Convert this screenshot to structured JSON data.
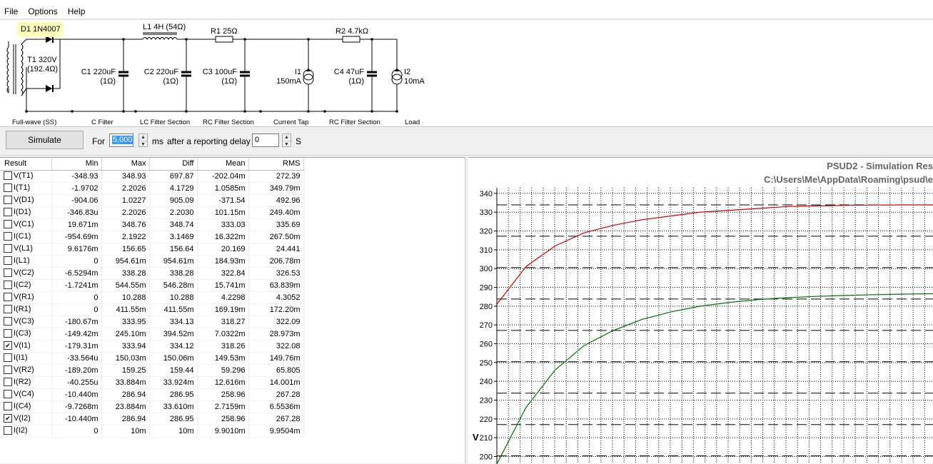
{
  "menu": [
    "File",
    "Options",
    "Help"
  ],
  "schematic": {
    "d1": "D1 1N4007",
    "l1": "L1 4H (54Ω)",
    "r1": "R1 25Ω",
    "r2": "R2 4.7kΩ",
    "t1_a": "T1 320V",
    "t1_b": "(192.4Ω)",
    "c1_a": "C1 220uF",
    "c1_b": "(1Ω)",
    "c2_a": "C2 220uF",
    "c2_b": "(1Ω)",
    "c3_a": "C3 100uF",
    "c3_b": "(1Ω)",
    "i1_a": "I1",
    "i1_b": "150mA",
    "c4_a": "C4 47uF",
    "c4_b": "(1Ω)",
    "i2_a": "I2",
    "i2_b": "10mA",
    "sections": [
      "Full-wave (SS)",
      "C Filter",
      "LC Filter Section",
      "RC Filter Section",
      "Current Tap",
      "RC Filter Section",
      "Load"
    ]
  },
  "sim": {
    "button": "Simulate",
    "for_label": "For",
    "duration": "5,000",
    "ms_label": "ms",
    "after_label": "after a reporting delay of",
    "delay": "0",
    "s_label": "S"
  },
  "table": {
    "headers": [
      "Result",
      "Min",
      "Max",
      "Diff",
      "Mean",
      "RMS"
    ],
    "rows": [
      {
        "name": "V(T1)",
        "checked": false,
        "min": "-348.93",
        "max": "348.93",
        "diff": "697.87",
        "mean": "-202.04m",
        "rms": "272.39"
      },
      {
        "name": "I(T1)",
        "checked": false,
        "min": "-1.9702",
        "max": "2.2026",
        "diff": "4.1729",
        "mean": "1.0585m",
        "rms": "349.79m"
      },
      {
        "name": "V(D1)",
        "checked": false,
        "min": "-904.06",
        "max": "1.0227",
        "diff": "905.09",
        "mean": "-371.54",
        "rms": "492.96"
      },
      {
        "name": "I(D1)",
        "checked": false,
        "min": "-346.83u",
        "max": "2.2026",
        "diff": "2.2030",
        "mean": "101.15m",
        "rms": "249.40m"
      },
      {
        "name": "V(C1)",
        "checked": false,
        "min": "19.671m",
        "max": "348.76",
        "diff": "348.74",
        "mean": "333.03",
        "rms": "335.69"
      },
      {
        "name": "I(C1)",
        "checked": false,
        "min": "-954.69m",
        "max": "2.1922",
        "diff": "3.1469",
        "mean": "16.322m",
        "rms": "267.50m"
      },
      {
        "name": "V(L1)",
        "checked": false,
        "min": "9.6176m",
        "max": "156.65",
        "diff": "156.64",
        "mean": "20.169",
        "rms": "24.441"
      },
      {
        "name": "I(L1)",
        "checked": false,
        "min": "0",
        "max": "954.61m",
        "diff": "954.61m",
        "mean": "184.93m",
        "rms": "206.78m"
      },
      {
        "name": "V(C2)",
        "checked": false,
        "min": "-6.5294m",
        "max": "338.28",
        "diff": "338.28",
        "mean": "322.84",
        "rms": "326.53"
      },
      {
        "name": "I(C2)",
        "checked": false,
        "min": "-1.7241m",
        "max": "544.55m",
        "diff": "546.28m",
        "mean": "15.741m",
        "rms": "63.839m"
      },
      {
        "name": "V(R1)",
        "checked": false,
        "min": "0",
        "max": "10.288",
        "diff": "10.288",
        "mean": "4.2298",
        "rms": "4.3052"
      },
      {
        "name": "I(R1)",
        "checked": false,
        "min": "0",
        "max": "411.55m",
        "diff": "411.55m",
        "mean": "169.19m",
        "rms": "172.20m"
      },
      {
        "name": "V(C3)",
        "checked": false,
        "min": "-180.67m",
        "max": "333.95",
        "diff": "334.13",
        "mean": "318.27",
        "rms": "322.09"
      },
      {
        "name": "I(C3)",
        "checked": false,
        "min": "-149.42m",
        "max": "245.10m",
        "diff": "394.52m",
        "mean": "7.0322m",
        "rms": "28.973m"
      },
      {
        "name": "V(I1)",
        "checked": true,
        "min": "-179.31m",
        "max": "333.94",
        "diff": "334.12",
        "mean": "318.26",
        "rms": "322.08"
      },
      {
        "name": "I(I1)",
        "checked": false,
        "min": "-33.564u",
        "max": "150.03m",
        "diff": "150.06m",
        "mean": "149.53m",
        "rms": "149.76m"
      },
      {
        "name": "V(R2)",
        "checked": false,
        "min": "-189.20m",
        "max": "159.25",
        "diff": "159.44",
        "mean": "59.296",
        "rms": "65.805"
      },
      {
        "name": "I(R2)",
        "checked": false,
        "min": "-40.255u",
        "max": "33.884m",
        "diff": "33.924m",
        "mean": "12.616m",
        "rms": "14.001m"
      },
      {
        "name": "V(C4)",
        "checked": false,
        "min": "-10.440m",
        "max": "286.94",
        "diff": "286.95",
        "mean": "258.96",
        "rms": "267.28"
      },
      {
        "name": "I(C4)",
        "checked": false,
        "min": "-9.7268m",
        "max": "23.884m",
        "diff": "33.610m",
        "mean": "2.7159m",
        "rms": "6.5536m"
      },
      {
        "name": "V(I2)",
        "checked": true,
        "min": "-10.440m",
        "max": "286.94",
        "diff": "286.95",
        "mean": "258.96",
        "rms": "267.28"
      },
      {
        "name": "I(I2)",
        "checked": false,
        "min": "0",
        "max": "10m",
        "diff": "10m",
        "mean": "9.9010m",
        "rms": "9.9504m"
      }
    ]
  },
  "chart": {
    "title": "PSUD2 - Simulation Res",
    "path": "C:\\Users\\Me\\AppData\\Roaming\\psud\\e",
    "ylabel": "V",
    "colors": {
      "v_i1": "#cc0000",
      "v_i2": "#007000",
      "grid": "#000000"
    }
  },
  "chart_data": {
    "type": "line",
    "ylabel": "V",
    "ylim": [
      196,
      343
    ],
    "yticks": [
      200,
      210,
      220,
      230,
      240,
      250,
      260,
      270,
      280,
      290,
      300,
      310,
      320,
      330,
      340
    ],
    "dashed_levels": [
      333.9,
      317.2,
      300.5,
      283.8,
      267.1,
      250.4,
      233.7,
      217.0,
      200.3
    ],
    "series": [
      {
        "color": "#cc0000",
        "y": [
          281,
          301,
          312,
          319,
          323,
          326,
          328,
          330,
          331,
          332,
          333,
          333.3,
          333.6,
          333.8,
          333.9,
          333.9
        ]
      },
      {
        "color": "#007000",
        "y": [
          196,
          226,
          246,
          259,
          267,
          273,
          277,
          280,
          282,
          283.5,
          284.5,
          285.2,
          285.7,
          286.1,
          286.4,
          286.6
        ]
      }
    ]
  }
}
